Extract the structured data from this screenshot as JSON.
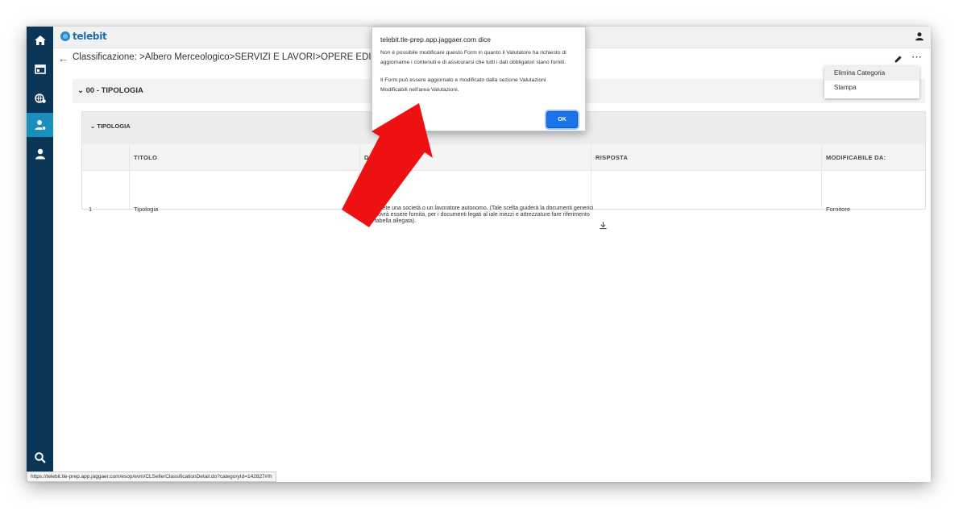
{
  "app": {
    "logo_text": "telebit"
  },
  "breadcrumb": {
    "text": "Classificazione: >Albero Merceologico>SERVIZI E LAVORI>OPERE EDILI/CIVIL"
  },
  "menu": {
    "items": [
      "Elimina Categoria",
      "Stampa"
    ]
  },
  "section": {
    "title": "00 - TIPOLOGIA"
  },
  "card": {
    "title": "TIPOLOGIA",
    "columns": [
      "TITOLO",
      "D",
      "RISPOSTA",
      "MODIFICABILE DA:"
    ],
    "rows": [
      {
        "num": "1",
        "titolo": "Tipologia",
        "descrizione": "re se siete una società o un lavoratore autonomo. (Tale scelta guiderà la documenti generici che dovrà essere fornita, per i documenti legati al iale mezzi e attrezzature fare riferimento alla tabella allegata).",
        "modificabile": "Fornitore"
      }
    ]
  },
  "dialog": {
    "title": "telebit.tle-prep.app.jaggaer.com dice",
    "message1": "Non è possibile modificare questo Form in quanto il Valutatore ha richiesto di aggiornarne i contenuti e di assicurarsi che tutti i dati obbligatori siano forniti.",
    "message2": "Il Form può essere aggiornato e modificato dalla sezione Valutazioni Modificabili nell'area Valutazioni.",
    "ok_label": "OK"
  },
  "status_url": "https://telebit.tle-prep.app.jaggaer.com/esop/evm/CLSellerClassificationDetail.do?categoryId=142827#!h",
  "colors": {
    "sidebar": "#0b3658",
    "sidebar_active": "#1a8fbd",
    "ok_button": "#1a73e8",
    "arrow": "#ee1111"
  }
}
